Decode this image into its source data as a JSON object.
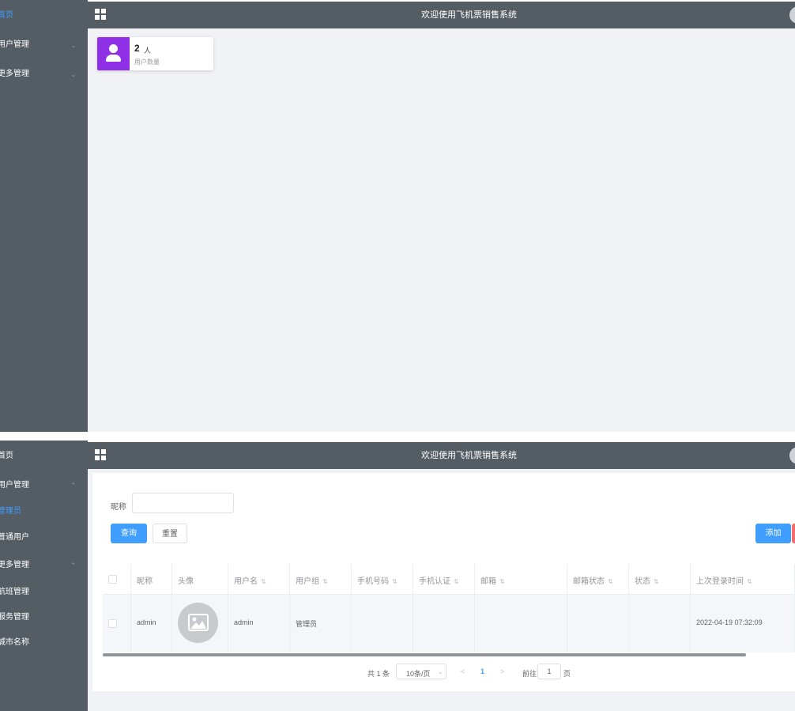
{
  "app_title": "欢迎使用飞机票销售系统",
  "screen1": {
    "sidebar": [
      {
        "label": "首页",
        "active": true
      },
      {
        "label": "用户管理",
        "chevron": "chevron-down-icon"
      },
      {
        "label": "更多管理",
        "chevron": "chevron-down-icon"
      }
    ],
    "stat_card": {
      "value": "2",
      "unit": "人",
      "label": "用户数量",
      "color": "#8f2fe6"
    }
  },
  "screen2": {
    "sidebar": [
      {
        "label": "首页"
      },
      {
        "label": "用户管理",
        "chevron": "chevron-up-icon"
      },
      {
        "label": "管理员",
        "active": true
      },
      {
        "label": "普通用户"
      },
      {
        "label": "更多管理",
        "chevron": "chevron-up-icon"
      },
      {
        "label": "航班管理"
      },
      {
        "label": "服务管理"
      },
      {
        "label": "城市名称"
      }
    ],
    "filter": {
      "nickname_label": "昵称",
      "nickname_value": ""
    },
    "buttons": {
      "query": "查询",
      "reset": "重置",
      "add": "添加"
    },
    "table": {
      "headers": [
        "昵称",
        "头像",
        "用户名",
        "用户组",
        "手机号码",
        "手机认证",
        "邮箱",
        "邮箱状态",
        "状态",
        "上次登录时间"
      ],
      "sort_icon": "⇅",
      "rows": [
        {
          "nickname": "admin",
          "username": "admin",
          "group": "管理员",
          "phone": "",
          "phone_verified": "",
          "email": "",
          "email_status": "",
          "status": "",
          "last_login": "2022-04-19 07:32:09"
        }
      ]
    },
    "pagination": {
      "total": "共 1 条",
      "page_size": "10条/页",
      "prev": "<",
      "current": "1",
      "next": ">",
      "goto": "前往",
      "goto_value": "1",
      "page_suffix": "页"
    }
  },
  "colors": {
    "sidebar_bg": "#545c64",
    "accent": "#409eff",
    "danger": "#f56c6c",
    "content_bg": "#f1f2f5"
  }
}
